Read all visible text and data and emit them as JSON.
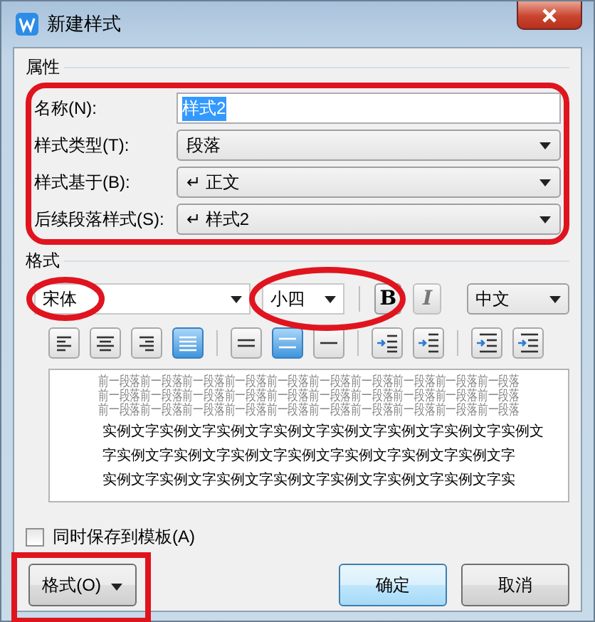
{
  "window": {
    "title": "新建样式"
  },
  "properties": {
    "label": "属性",
    "highlighted": true,
    "fields": [
      {
        "label": "名称(N):",
        "kind": "text",
        "value": "样式2",
        "selected": true
      },
      {
        "label": "样式类型(T):",
        "kind": "dropdown",
        "value": "段落"
      },
      {
        "label": "样式基于(B):",
        "kind": "dropdown",
        "value": "↵ 正文"
      },
      {
        "label": "后续段落样式(S):",
        "kind": "dropdown",
        "value": "↵ 样式2"
      }
    ]
  },
  "format": {
    "label": "格式",
    "font": {
      "value": "宋体",
      "circled": true
    },
    "size": {
      "value": "小四",
      "circled": true
    },
    "bold": {
      "label": "B"
    },
    "italic": {
      "label": "I"
    },
    "language": {
      "value": "中文"
    },
    "tool_groups": [
      [
        {
          "kind": "align-left",
          "selected": false
        },
        {
          "kind": "align-center",
          "selected": false
        },
        {
          "kind": "align-right",
          "selected": false
        },
        {
          "kind": "justify",
          "selected": true
        }
      ],
      [
        {
          "kind": "single-spacing",
          "selected": false
        },
        {
          "kind": "medium-spacing",
          "selected": true
        },
        {
          "kind": "double-spacing",
          "selected": false
        }
      ],
      [
        {
          "kind": "space-before",
          "selected": false
        },
        {
          "kind": "space-after",
          "selected": false
        }
      ],
      [
        {
          "kind": "indent-decrease",
          "selected": false
        },
        {
          "kind": "indent-increase",
          "selected": false
        }
      ]
    ]
  },
  "preview": {
    "previous_lines": [
      "前一段落前一段落前一段落前一段落前一段落前一段落前一段落前一段落前一段落前一段落",
      "前一段落前一段落前一段落前一段落前一段落前一段落前一段落前一段落前一段落前一段落",
      "前一段落前一段落前一段落前一段落前一段落前一段落前一段落前一段落前一段落前一段落"
    ],
    "sample_lines": [
      "实例文字实例文字实例文字实例文字实例文字实例文字实例文字实例文",
      "字实例文字实例文字实例文字实例文字实例文字实例文字实例文字",
      "实例文字实例文字实例文字实例文字实例文字实例文字实例文字实"
    ]
  },
  "save_to_template": {
    "label": "同时保存到模板(A)",
    "checked": false
  },
  "buttons": [
    {
      "label": "格式(O)",
      "kind": "menu",
      "boxed": true
    },
    {
      "label": "确定",
      "kind": "default"
    },
    {
      "label": "取消",
      "kind": "normal"
    }
  ]
}
